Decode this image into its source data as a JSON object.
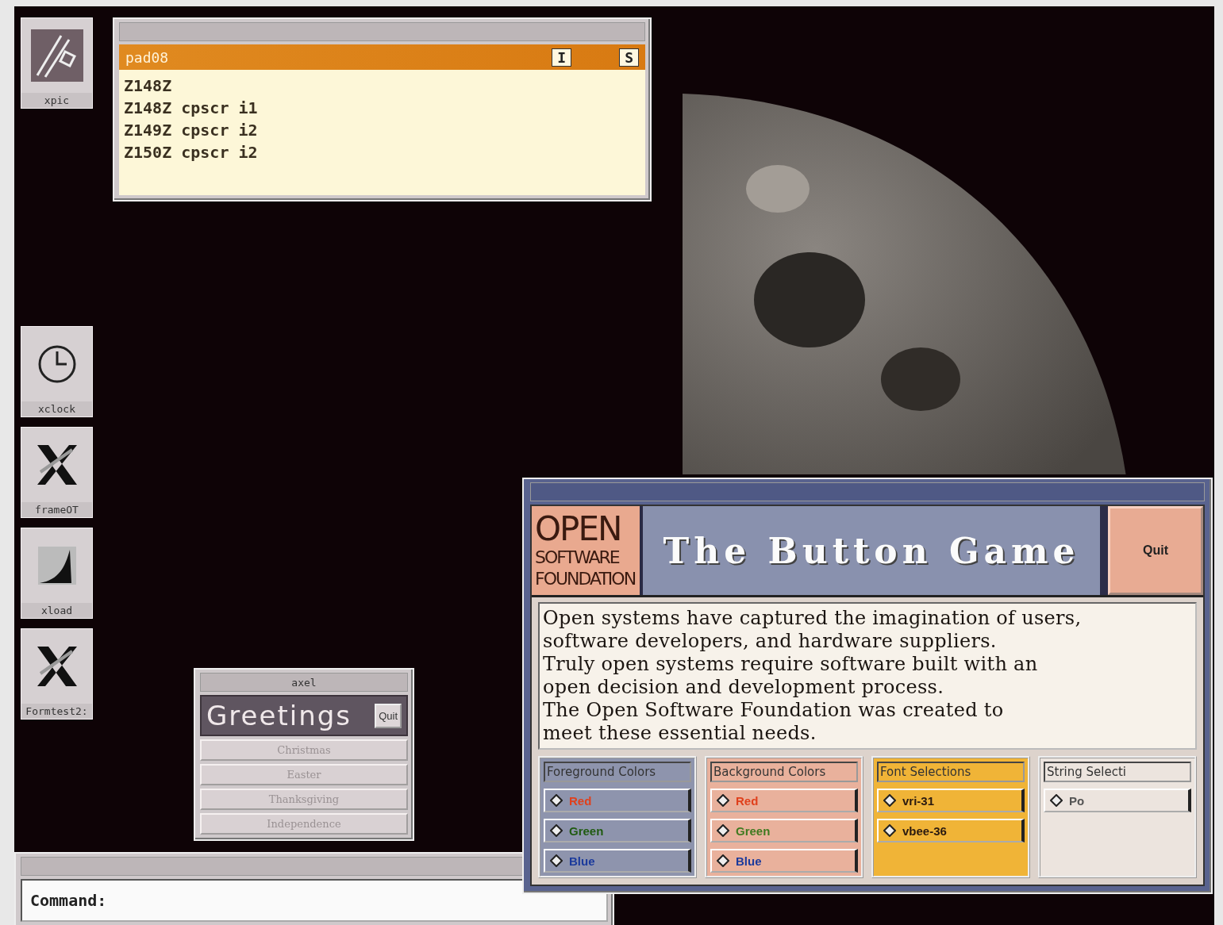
{
  "icons": [
    {
      "label": "xpic",
      "kind": "picture"
    },
    {
      "label": "xclock",
      "kind": "clock"
    },
    {
      "label": "frameOT",
      "kind": "x"
    },
    {
      "label": "xload",
      "kind": "load"
    },
    {
      "label": "Formtest2:",
      "kind": "x"
    }
  ],
  "pad_window": {
    "header": "pad08",
    "header_buttons": [
      "I",
      "S"
    ],
    "lines": [
      "Z148Z",
      "Z148Z cpscr i1",
      "Z149Z cpscr i2",
      "Z150Z cpscr i2"
    ]
  },
  "greetings_window": {
    "title": "axel",
    "heading": "Greetings",
    "quit": "Quit",
    "buttons": [
      {
        "label": "Christmas",
        "disabled": true
      },
      {
        "label": "Easter",
        "disabled": true
      },
      {
        "label": "Thanksgiving",
        "disabled": true
      },
      {
        "label": "Independence",
        "disabled": true
      }
    ]
  },
  "command_window": {
    "label": "Command:"
  },
  "button_game": {
    "logo": [
      "OPEN",
      "SOFTWARE",
      "FOUNDATION"
    ],
    "title": "The Button Game",
    "quit": "Quit",
    "paragraph": [
      "Open systems have captured the imagination of users,",
      "software developers, and hardware suppliers.",
      "Truly open systems require software built with an",
      "open decision and development process.",
      "The Open Software Foundation was created to",
      "meet these essential needs."
    ],
    "groups": [
      {
        "title": "Foreground Colors",
        "color": "#8e94ad",
        "items": [
          {
            "label": "Red",
            "color": "#e0401c"
          },
          {
            "label": "Green",
            "color": "#1f5a10"
          },
          {
            "label": "Blue",
            "color": "#1b3a9c"
          }
        ]
      },
      {
        "title": "Background Colors",
        "color": "#e9b19c",
        "items": [
          {
            "label": "Red",
            "color": "#e0401c"
          },
          {
            "label": "Green",
            "color": "#3f7a20"
          },
          {
            "label": "Blue",
            "color": "#1b3a9c"
          }
        ]
      },
      {
        "title": "Font Selections",
        "color": "#f0b437",
        "items": [
          {
            "label": "vri-31",
            "color": "#2a1a10"
          },
          {
            "label": "vbee-36",
            "color": "#2a1a10"
          }
        ]
      },
      {
        "title": "String Selecti",
        "color": "#ece4de",
        "items": [
          {
            "label": "Po",
            "color": "#555555"
          }
        ]
      }
    ]
  }
}
